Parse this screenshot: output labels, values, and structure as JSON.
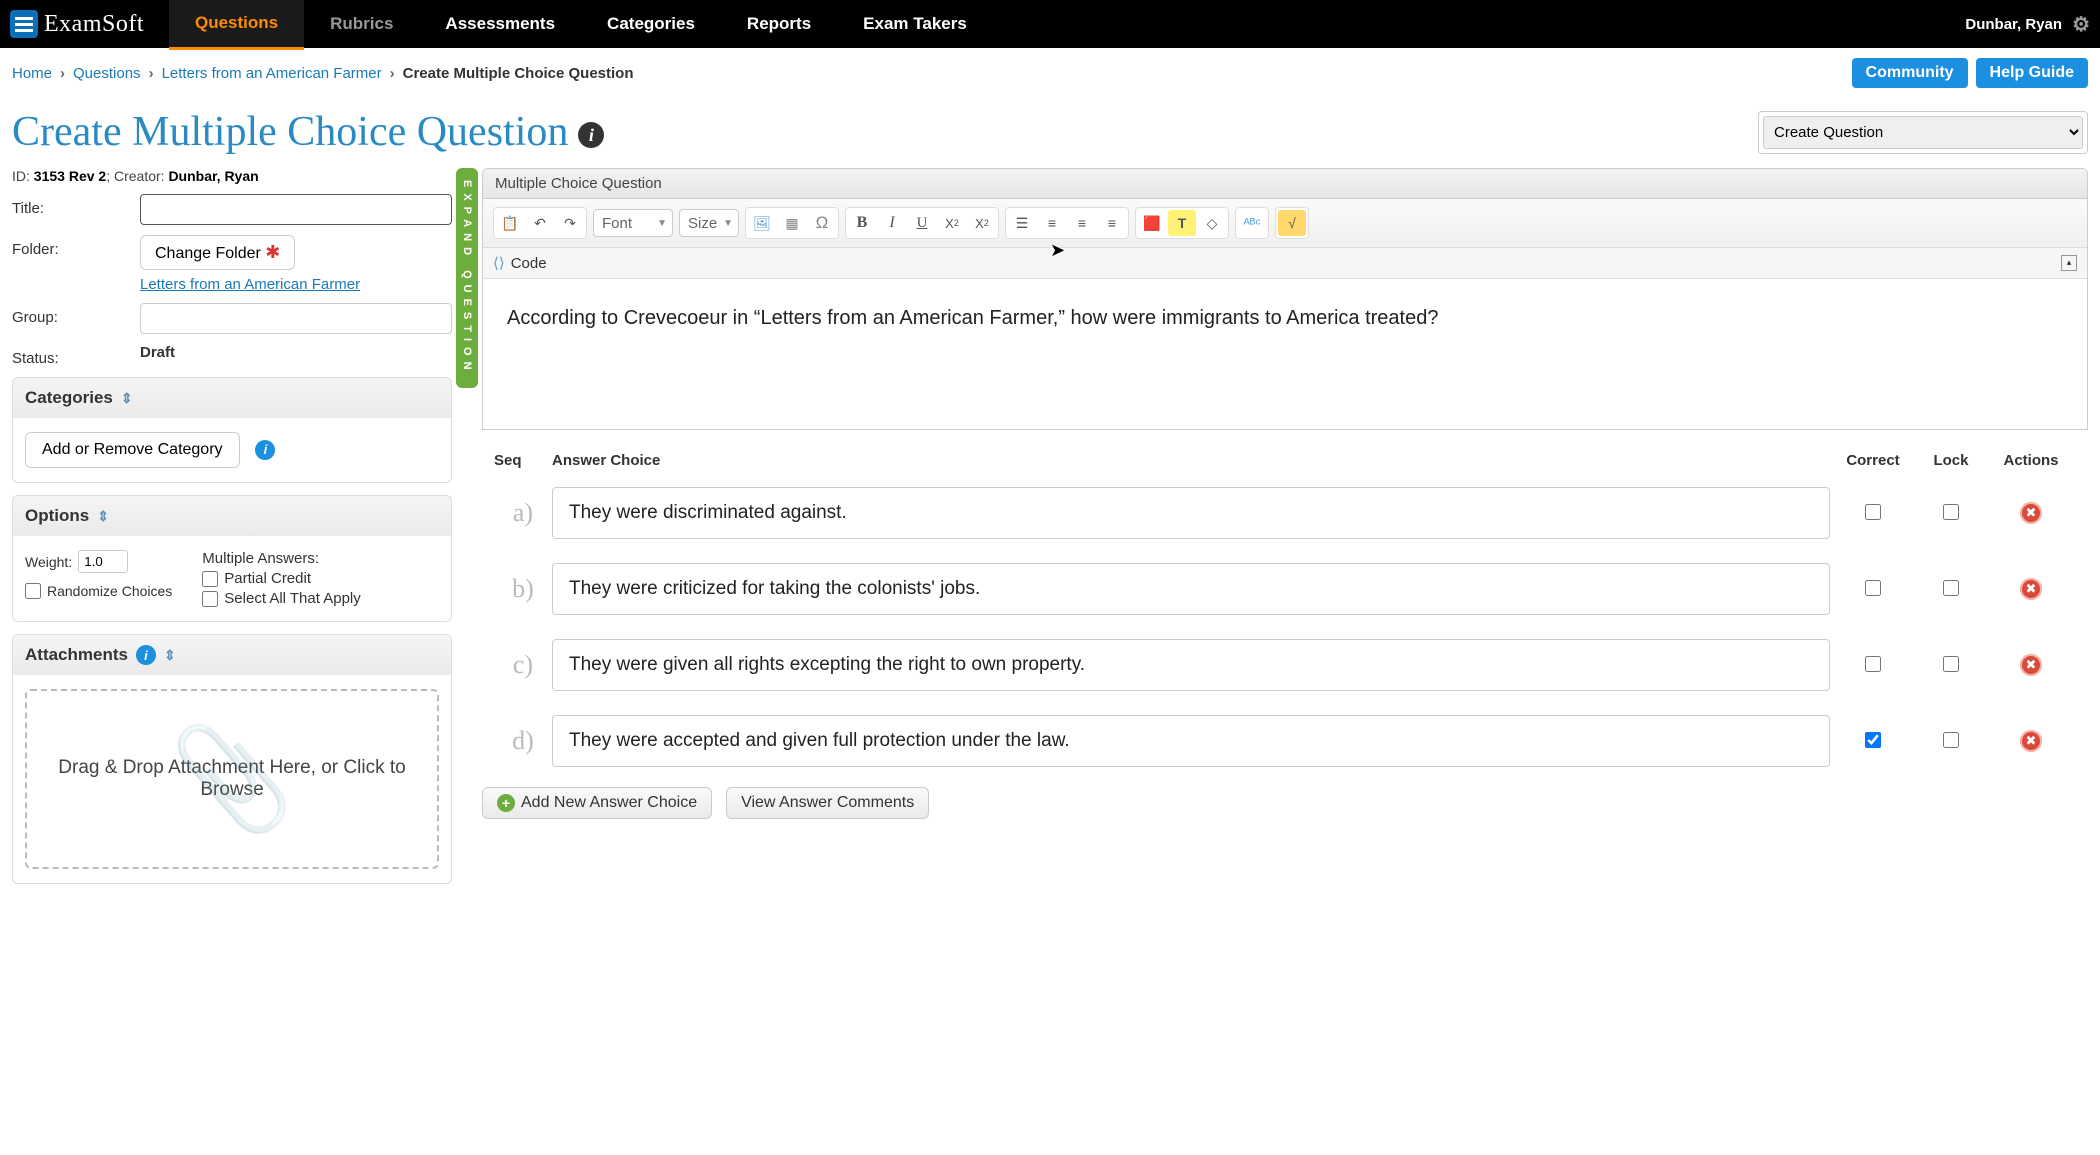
{
  "brand": {
    "exam": "Exam",
    "soft": "Soft"
  },
  "nav": [
    "Questions",
    "Rubrics",
    "Assessments",
    "Categories",
    "Reports",
    "Exam Takers"
  ],
  "user_name": "Dunbar, Ryan",
  "breadcrumb": {
    "home": "Home",
    "questions": "Questions",
    "folder": "Letters from an American Farmer",
    "current": "Create Multiple Choice Question"
  },
  "subbar_buttons": {
    "community": "Community",
    "help": "Help Guide"
  },
  "page_title": "Create Multiple Choice Question",
  "create_select": "Create Question",
  "expand_label": "EXPAND QUESTION",
  "meta": {
    "id": "3153",
    "rev": "Rev 2",
    "creator_label": "Creator:",
    "creator_name": "Dunbar, Ryan"
  },
  "form": {
    "title_label": "Title:",
    "title_value": "",
    "folder_label": "Folder:",
    "change_folder": "Change Folder",
    "folder_link": "Letters from an American Farmer",
    "group_label": "Group:",
    "group_value": "",
    "status_label": "Status:",
    "status_value": "Draft"
  },
  "categories": {
    "header": "Categories",
    "button": "Add or Remove Category"
  },
  "options": {
    "header": "Options",
    "weight_label": "Weight:",
    "weight_value": "1.0",
    "randomize": "Randomize Choices",
    "multiple_answers": "Multiple Answers:",
    "partial": "Partial Credit",
    "select_all": "Select All That Apply"
  },
  "attachments": {
    "header": "Attachments",
    "drop": "Drag & Drop Attachment Here, or Click to Browse"
  },
  "editor": {
    "header": "Multiple Choice Question",
    "font": "Font",
    "size": "Size",
    "code": "Code"
  },
  "question_text": "According to Crevecoeur in “Letters from an American Farmer,” how were immigrants to America treated?",
  "answer_headers": {
    "seq": "Seq",
    "choice": "Answer Choice",
    "correct": "Correct",
    "lock": "Lock",
    "actions": "Actions"
  },
  "answers": [
    {
      "seq": "a)",
      "text": "They were discriminated against.",
      "correct": false
    },
    {
      "seq": "b)",
      "text": "They were criticized for taking the colonists' jobs.",
      "correct": false
    },
    {
      "seq": "c)",
      "text": "They were given all rights excepting the right to own property.",
      "correct": false
    },
    {
      "seq": "d)",
      "text": "They were accepted and given full protection under the law.",
      "correct": true
    }
  ],
  "footer_buttons": {
    "add": "Add New Answer Choice",
    "view": "View Answer Comments"
  }
}
